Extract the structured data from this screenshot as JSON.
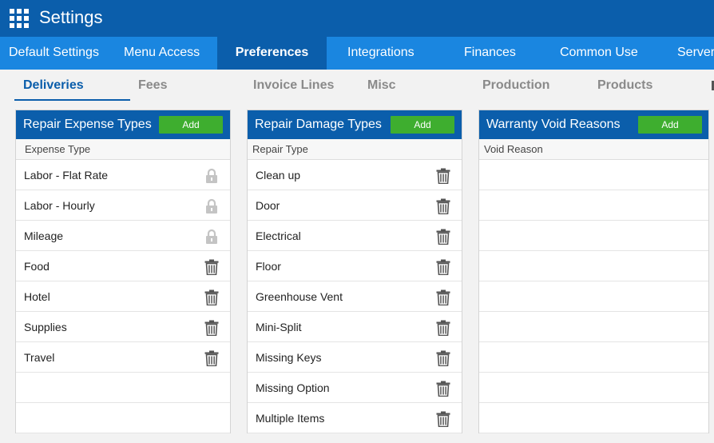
{
  "app": {
    "title": "Settings"
  },
  "main_tabs": [
    {
      "label": "Default Settings"
    },
    {
      "label": "Menu Access"
    },
    {
      "label": "Preferences"
    },
    {
      "label": "Integrations"
    },
    {
      "label": "Finances"
    },
    {
      "label": "Common Use"
    },
    {
      "label": "Server"
    }
  ],
  "active_main_tab": "Preferences",
  "sub_tabs": [
    {
      "label": "Deliveries"
    },
    {
      "label": "Fees"
    },
    {
      "label": "Invoice Lines"
    },
    {
      "label": "Misc"
    },
    {
      "label": "Production"
    },
    {
      "label": "Products"
    }
  ],
  "active_sub_tab": "Deliveries",
  "panels": [
    {
      "title": "Repair Expense Types",
      "add_label": "Add",
      "column": "Expense Type",
      "rows": [
        {
          "label": "Labor - Flat Rate",
          "icon": "lock-icon"
        },
        {
          "label": "Labor - Hourly",
          "icon": "lock-icon"
        },
        {
          "label": "Mileage",
          "icon": "lock-icon"
        },
        {
          "label": "Food",
          "icon": "trash-icon"
        },
        {
          "label": "Hotel",
          "icon": "trash-icon"
        },
        {
          "label": "Supplies",
          "icon": "trash-icon"
        },
        {
          "label": "Travel",
          "icon": "trash-icon"
        }
      ]
    },
    {
      "title": "Repair Damage Types",
      "add_label": "Add",
      "column": "Repair Type",
      "rows": [
        {
          "label": "Clean up",
          "icon": "trash-icon"
        },
        {
          "label": "Door",
          "icon": "trash-icon"
        },
        {
          "label": "Electrical",
          "icon": "trash-icon"
        },
        {
          "label": "Floor",
          "icon": "trash-icon"
        },
        {
          "label": "Greenhouse Vent",
          "icon": "trash-icon"
        },
        {
          "label": "Mini-Split",
          "icon": "trash-icon"
        },
        {
          "label": "Missing Keys",
          "icon": "trash-icon"
        },
        {
          "label": "Missing Option",
          "icon": "trash-icon"
        },
        {
          "label": "Multiple Items",
          "icon": "trash-icon"
        }
      ]
    },
    {
      "title": "Warranty Void Reasons",
      "add_label": "Add",
      "column": "Void Reason",
      "rows": []
    }
  ],
  "colors": {
    "header_blue": "#0b5eab",
    "nav_blue": "#1a86e0",
    "add_green": "#3eae2f",
    "lock_gray": "#c4c4c4",
    "trash_gray": "#555555"
  }
}
